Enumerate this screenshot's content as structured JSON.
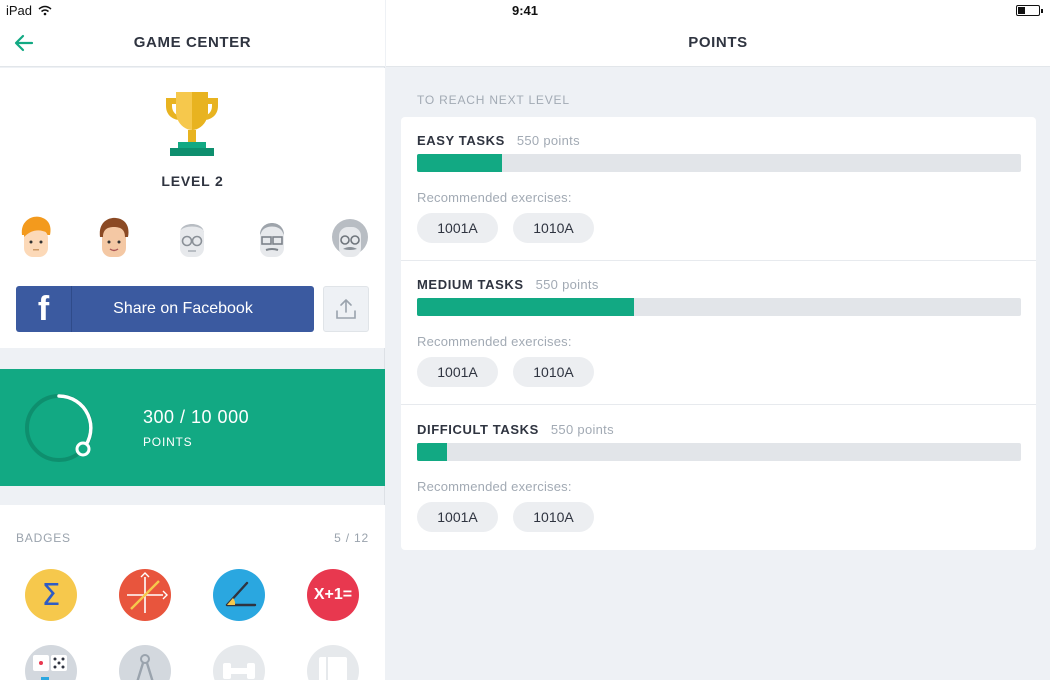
{
  "status_bar": {
    "device": "iPad",
    "time": "9:41"
  },
  "left_panel": {
    "title": "GAME CENTER",
    "level": "LEVEL 2",
    "avatars": [
      "orange-hair-avatar",
      "brown-hair-avatar",
      "glasses-avatar",
      "glasses-avatar-2",
      "grandpa-avatar"
    ],
    "share_facebook_label": "Share on Facebook",
    "points": {
      "value": "300 / 10 000",
      "label": "POINTS",
      "progress": 0.03
    },
    "badges": {
      "title": "BADGES",
      "count": "5 / 12",
      "items": [
        {
          "name": "sigma",
          "color": "#f6c84c",
          "glyph": "Σ"
        },
        {
          "name": "axes",
          "color": "#e8553d",
          "glyph": "✛"
        },
        {
          "name": "angle",
          "color": "#2aa7e0",
          "glyph": "∠"
        },
        {
          "name": "equation",
          "color": "#e8384f",
          "glyph": "x+1="
        },
        {
          "name": "dice",
          "color": "#d3d8de",
          "glyph": "⚅"
        },
        {
          "name": "compass",
          "color": "#d3d8de",
          "glyph": "⟑"
        },
        {
          "name": "dumbbell",
          "color": "#e6e9ec",
          "glyph": "▬"
        },
        {
          "name": "book",
          "color": "#e6e9ec",
          "glyph": "▭"
        }
      ]
    }
  },
  "right_panel": {
    "title": "POINTS",
    "section_label": "TO REACH NEXT LEVEL",
    "tasks": [
      {
        "name": "EASY TASKS",
        "points": "550 points",
        "progress": 0.14,
        "recommended_label": "Recommended exercises:",
        "exercises": [
          "1001A",
          "1010A"
        ]
      },
      {
        "name": "MEDIUM TASKS",
        "points": "550 points",
        "progress": 0.36,
        "recommended_label": "Recommended exercises:",
        "exercises": [
          "1001A",
          "1010A"
        ]
      },
      {
        "name": "DIFFICULT TASKS",
        "points": "550 points",
        "progress": 0.05,
        "recommended_label": "Recommended exercises:",
        "exercises": [
          "1001A",
          "1010A"
        ]
      }
    ]
  },
  "colors": {
    "accent": "#12a983",
    "facebook": "#3b5aa0",
    "background": "#eef1f5"
  }
}
